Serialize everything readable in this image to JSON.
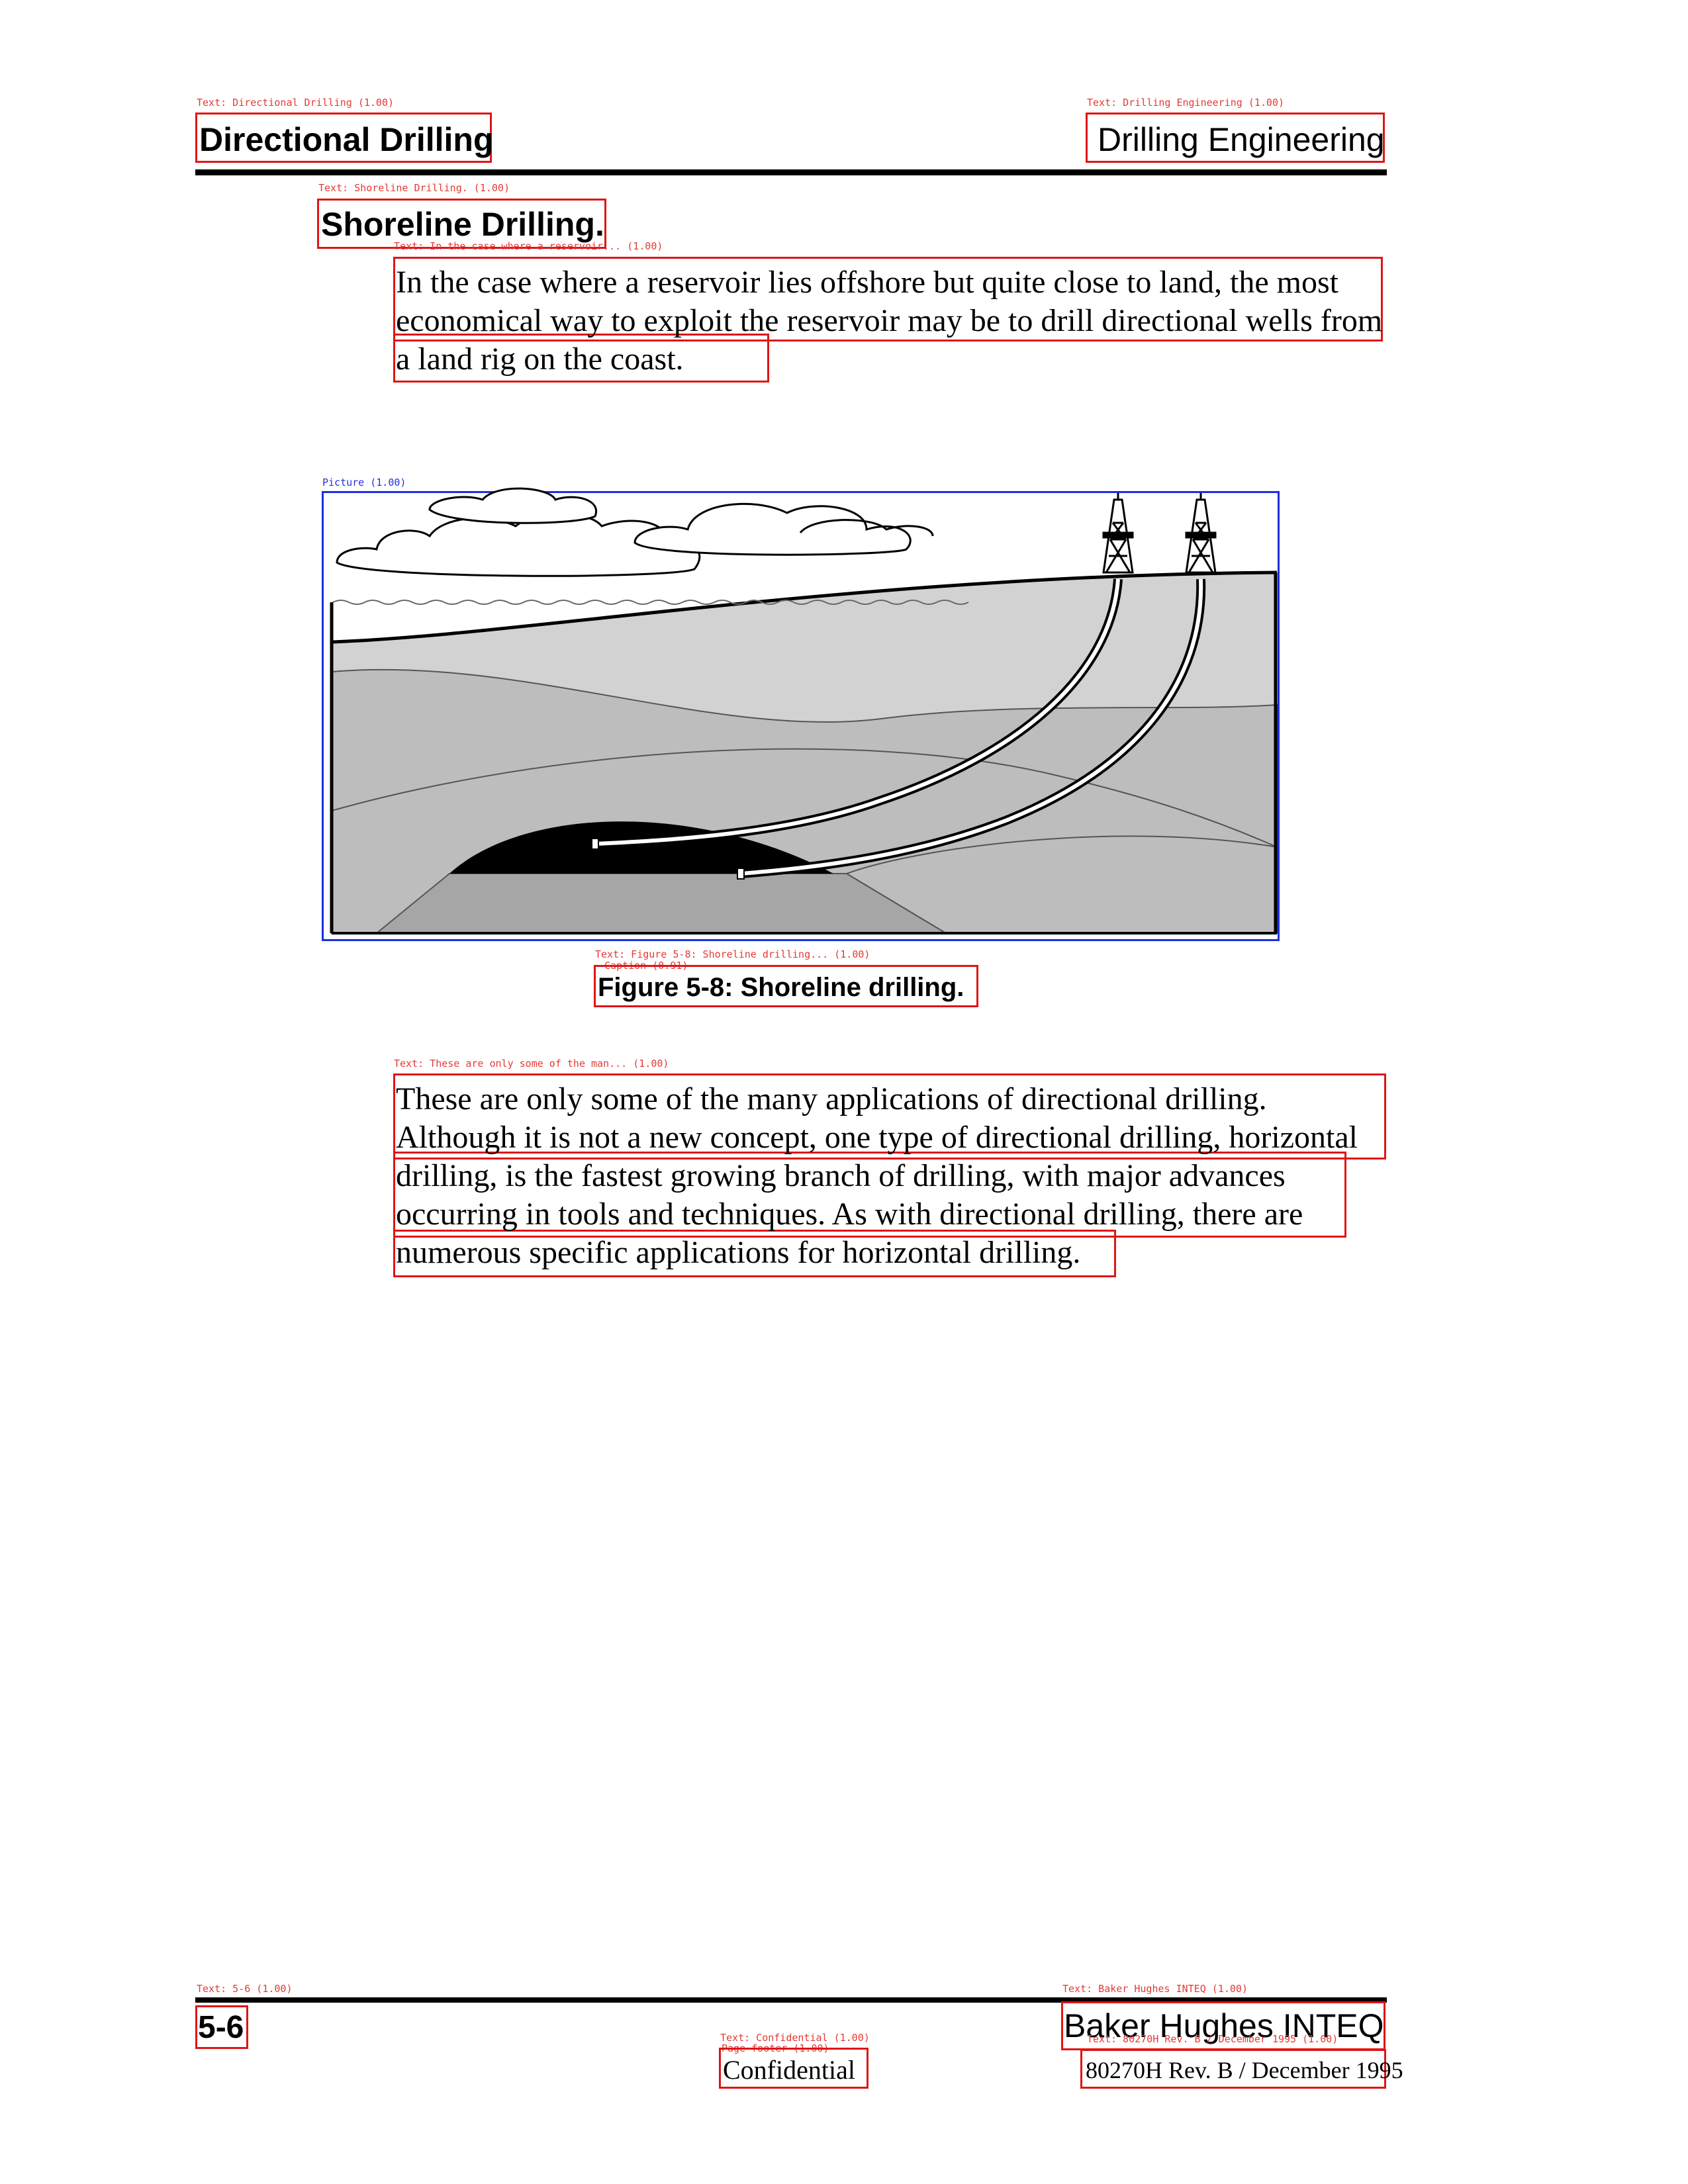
{
  "header": {
    "left_title": "Directional Drilling",
    "right_title": "Drilling Engineering",
    "left_annotation": "Text: Directional Drilling (1.00)",
    "right_annotation": "Text: Drilling Engineering (1.00)"
  },
  "section": {
    "title": "Shoreline Drilling.",
    "annotation": "Text: Shoreline Drilling. (1.00)"
  },
  "paragraph1": {
    "text": "In the case where a reservoir lies offshore but quite close to land, the most economical way to exploit the reservoir may be to drill directional wells from a land rig on the coast.",
    "annotation": "Text: In the case where a reservoir... (1.00)"
  },
  "figure": {
    "annotation": "Picture (1.00)",
    "caption": "Figure 5-8: Shoreline drilling.",
    "caption_annotation": "Text: Figure 5-8: Shoreline drilling... (1.00)",
    "caption_annotation_2": "Caption (0.91)"
  },
  "paragraph2": {
    "text": "These are only some of the many applications of directional drilling. Although it is not a new concept, one type of directional drilling, horizontal drilling, is the fastest growing branch of drilling, with major advances occurring in tools and techniques. As with directional drilling, there are numerous specific applications for horizontal drilling.",
    "annotation": "Text: These are only some of the man... (1.00)"
  },
  "footer": {
    "page_number": "5-6",
    "page_annotation": "Text: 5-6 (1.00)",
    "company": "Baker Hughes INTEQ",
    "company_annotation": "Text: Baker Hughes INTEQ (1.00)",
    "confidential": "Confidential",
    "confidential_annotation": "Text: Confidential (1.00)",
    "confidential_annotation_2": "Page-footer (1.00)",
    "revision": "80270H Rev. B / December 1995",
    "revision_annotation": "Text: 80270H Rev. B / December 1995 (1.00)"
  },
  "colors": {
    "annotation_red": "#e01515",
    "annotation_blue": "#1a2fe0",
    "land_light": "#d2d2d2",
    "layer_mid": "#bdbdbd",
    "layer_dark": "#a6a6a6",
    "reservoir": "#000000"
  }
}
